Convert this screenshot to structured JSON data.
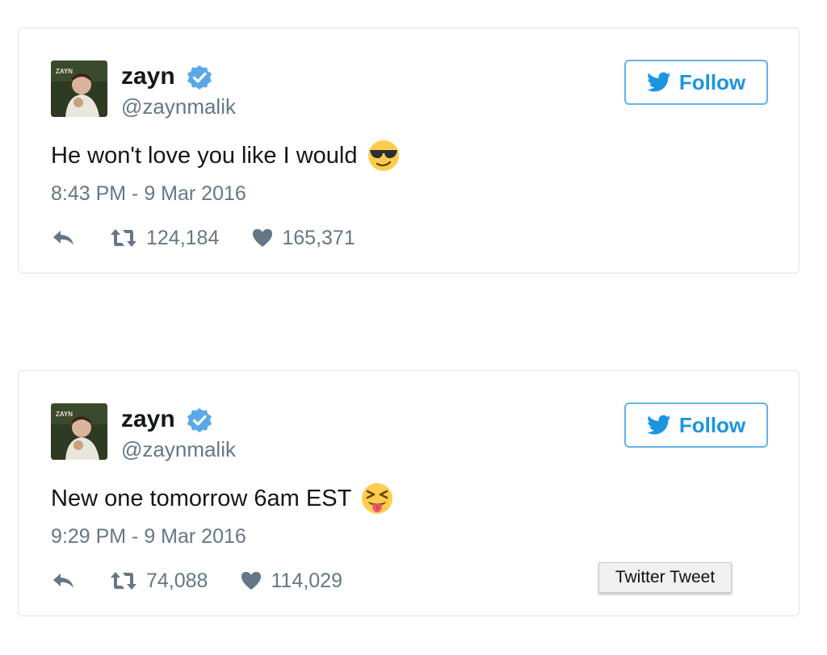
{
  "colors": {
    "twitter_blue": "#1b95e0",
    "follow_border": "#66b2e8",
    "verified_blue": "#5aa9e6",
    "secondary_text": "#657786",
    "primary_text": "#14171a"
  },
  "tweets": [
    {
      "display_name": "zayn",
      "handle": "@zaynmalik",
      "verified": true,
      "follow_label": "Follow",
      "text": "He won't love you like I would",
      "emoji": "smiling-face-with-sunglasses",
      "timestamp": "8:43 PM - 9 Mar 2016",
      "retweets": "124,184",
      "likes": "165,371",
      "avatar_text": "ZAYN"
    },
    {
      "display_name": "zayn",
      "handle": "@zaynmalik",
      "verified": true,
      "follow_label": "Follow",
      "text": "New one tomorrow 6am EST",
      "emoji": "squinting-face-with-tongue",
      "timestamp": "9:29 PM - 9 Mar 2016",
      "retweets": "74,088",
      "likes": "114,029",
      "avatar_text": "ZAYN"
    }
  ],
  "tooltip": {
    "text": "Twitter Tweet"
  }
}
